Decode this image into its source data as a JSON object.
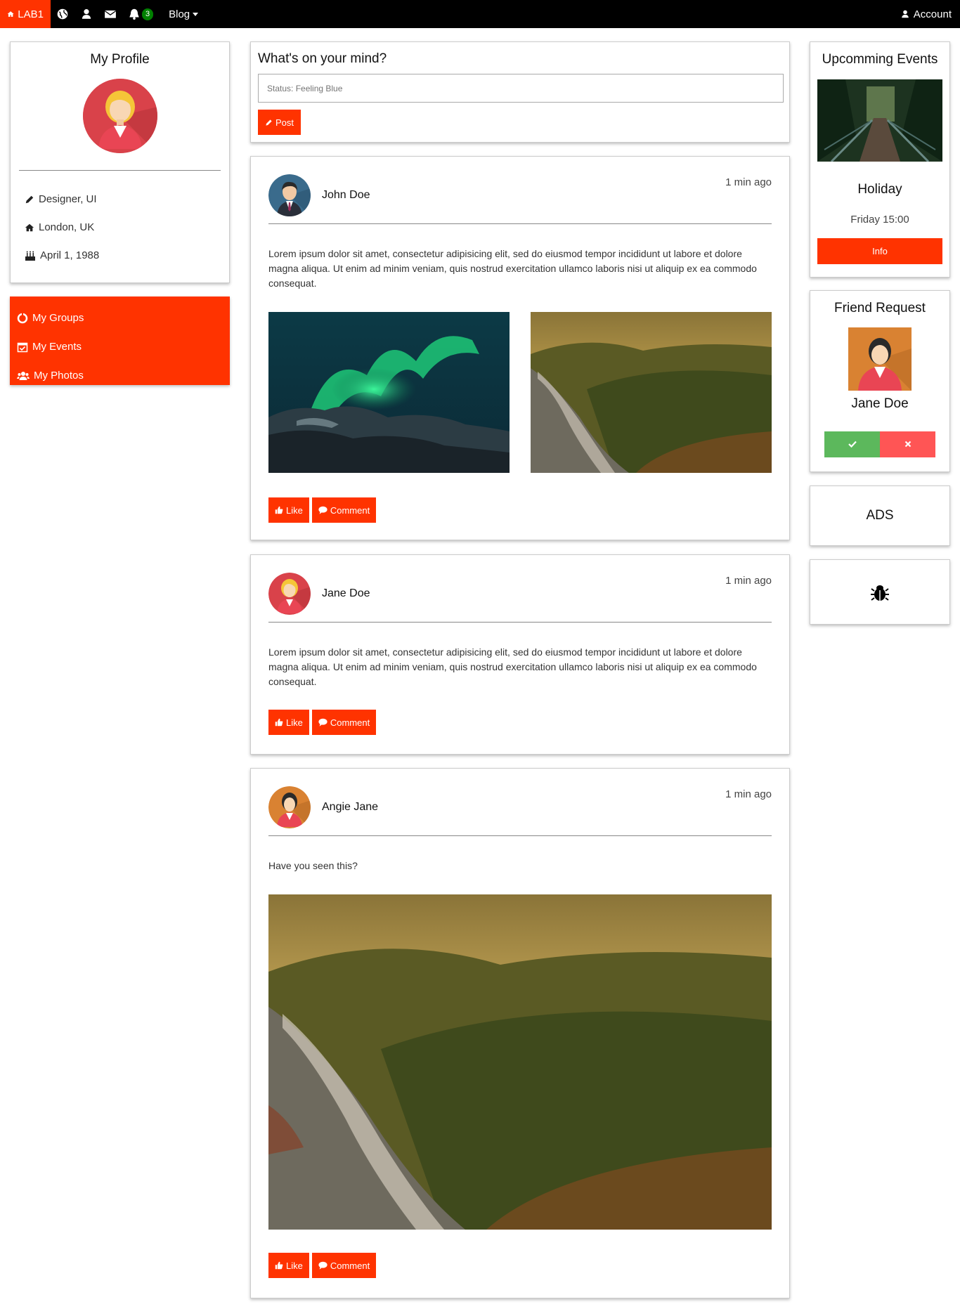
{
  "nav": {
    "brand": "LAB1",
    "notification_count": "3",
    "blog_label": "Blog",
    "account_label": "Account"
  },
  "profile": {
    "title": "My Profile",
    "job": "Designer, UI",
    "location": "London, UK",
    "birthday": "April 1, 1988"
  },
  "groups": {
    "items": [
      "My Groups",
      "My Events",
      "My Photos"
    ]
  },
  "status": {
    "title": "What's on your mind?",
    "placeholder": "Status: Feeling Blue",
    "post_label": "Post"
  },
  "posts": [
    {
      "author": "John Doe",
      "time": "1 min ago",
      "text": "Lorem ipsum dolor sit amet, consectetur adipisicing elit, sed do eiusmod tempor incididunt ut labore et dolore magna aliqua. Ut enim ad minim veniam, quis nostrud exercitation ullamco laboris nisi ut aliquip ex ea commodo consequat.",
      "like_label": "Like",
      "comment_label": "Comment"
    },
    {
      "author": "Jane Doe",
      "time": "1 min ago",
      "text": "Lorem ipsum dolor sit amet, consectetur adipisicing elit, sed do eiusmod tempor incididunt ut labore et dolore magna aliqua. Ut enim ad minim veniam, quis nostrud exercitation ullamco laboris nisi ut aliquip ex ea commodo consequat.",
      "like_label": "Like",
      "comment_label": "Comment"
    },
    {
      "author": "Angie Jane",
      "time": "1 min ago",
      "text": "Have you seen this?",
      "like_label": "Like",
      "comment_label": "Comment"
    }
  ],
  "events": {
    "title": "Upcomming Events",
    "name": "Holiday",
    "time": "Friday 15:00",
    "info_label": "Info"
  },
  "friend_request": {
    "title": "Friend Request",
    "name": "Jane Doe"
  },
  "ads": {
    "label": "ADS"
  },
  "colors": {
    "accent": "#ff3300",
    "navbar": "#000000",
    "badge": "#008000",
    "accept": "#5cb85c",
    "decline": "#ff5555"
  }
}
